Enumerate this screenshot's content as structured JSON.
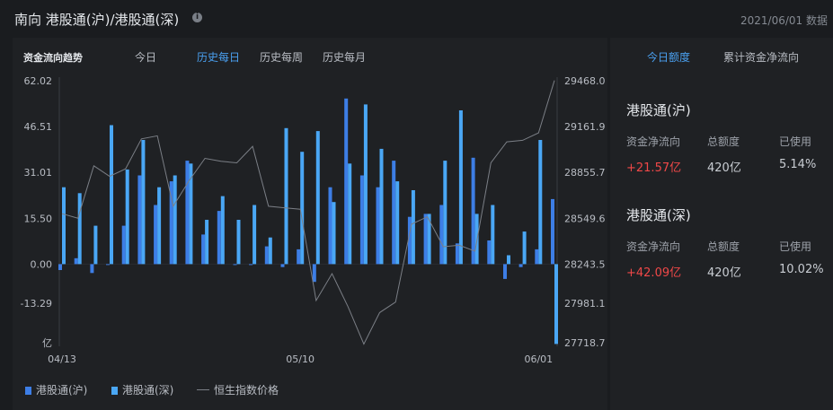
{
  "header": {
    "title": "南向 港股通(沪)/港股通(深)",
    "date": "2021/06/01 数据"
  },
  "tabs": {
    "title": "资金流向趋势",
    "items": [
      "今日",
      "历史每日",
      "历史每周",
      "历史每月"
    ],
    "active": 1
  },
  "right": {
    "tabs": [
      "今日额度",
      "累计资金净流向"
    ],
    "active": 0,
    "sections": [
      {
        "title": "港股通(沪)",
        "labels": [
          "资金净流向",
          "总额度",
          "已使用"
        ],
        "values": [
          "+21.57亿",
          "420亿",
          "5.14%"
        ]
      },
      {
        "title": "港股通(深)",
        "labels": [
          "资金净流向",
          "总额度",
          "已使用"
        ],
        "values": [
          "+42.09亿",
          "420亿",
          "10.02%"
        ]
      }
    ]
  },
  "colors": {
    "sh": "#3d7ee6",
    "sz": "#4aa7f5",
    "line": "#7b7f86",
    "positive": "#f04848"
  },
  "chart_data": {
    "type": "bar",
    "left_axis": {
      "ticks": [
        "62.02",
        "46.51",
        "31.01",
        "15.50",
        "0.00",
        "-13.29",
        "亿"
      ],
      "values": [
        62.02,
        46.51,
        31.01,
        15.5,
        0,
        -13.29,
        -26.58
      ]
    },
    "right_axis": {
      "ticks": [
        "29468.0",
        "29161.9",
        "28855.7",
        "28549.6",
        "28243.5",
        "27981.1",
        "27718.7"
      ],
      "values": [
        29468.0,
        29161.9,
        28855.7,
        28549.6,
        28243.5,
        27981.1,
        27718.7
      ]
    },
    "x_labels": [
      {
        "text": "04/13",
        "index": 0
      },
      {
        "text": "05/10",
        "index": 15
      },
      {
        "text": "06/01",
        "index": 30
      }
    ],
    "legend": [
      "港股通(沪)",
      "港股通(深)",
      "恒生指数价格"
    ],
    "series": [
      {
        "name": "港股通(沪)",
        "values": [
          -2,
          2,
          -3,
          0,
          13,
          30,
          20,
          28,
          35,
          10,
          18,
          0,
          0,
          6,
          -1,
          5,
          -6,
          26,
          56,
          30,
          26,
          35,
          16,
          17,
          20,
          7,
          36,
          8,
          -5,
          -1,
          5,
          22
        ]
      },
      {
        "name": "港股通(深)",
        "values": [
          26,
          24,
          13,
          47,
          32,
          42,
          26,
          30,
          34,
          15,
          23,
          15,
          20,
          9,
          46,
          38,
          45,
          21,
          34,
          54,
          39,
          28,
          25,
          17,
          35,
          52,
          17,
          20,
          3,
          11,
          42,
          -27
        ]
      },
      {
        "name": "恒生指数价格",
        "values": [
          28580,
          28550,
          28900,
          28830,
          28880,
          29080,
          29100,
          28630,
          28800,
          28950,
          28930,
          28920,
          29030,
          28630,
          28620,
          28610,
          28000,
          28180,
          27960,
          27710,
          27920,
          27990,
          28510,
          28560,
          28360,
          28370,
          28330,
          28920,
          29060,
          29070,
          29120,
          29470
        ]
      }
    ]
  }
}
